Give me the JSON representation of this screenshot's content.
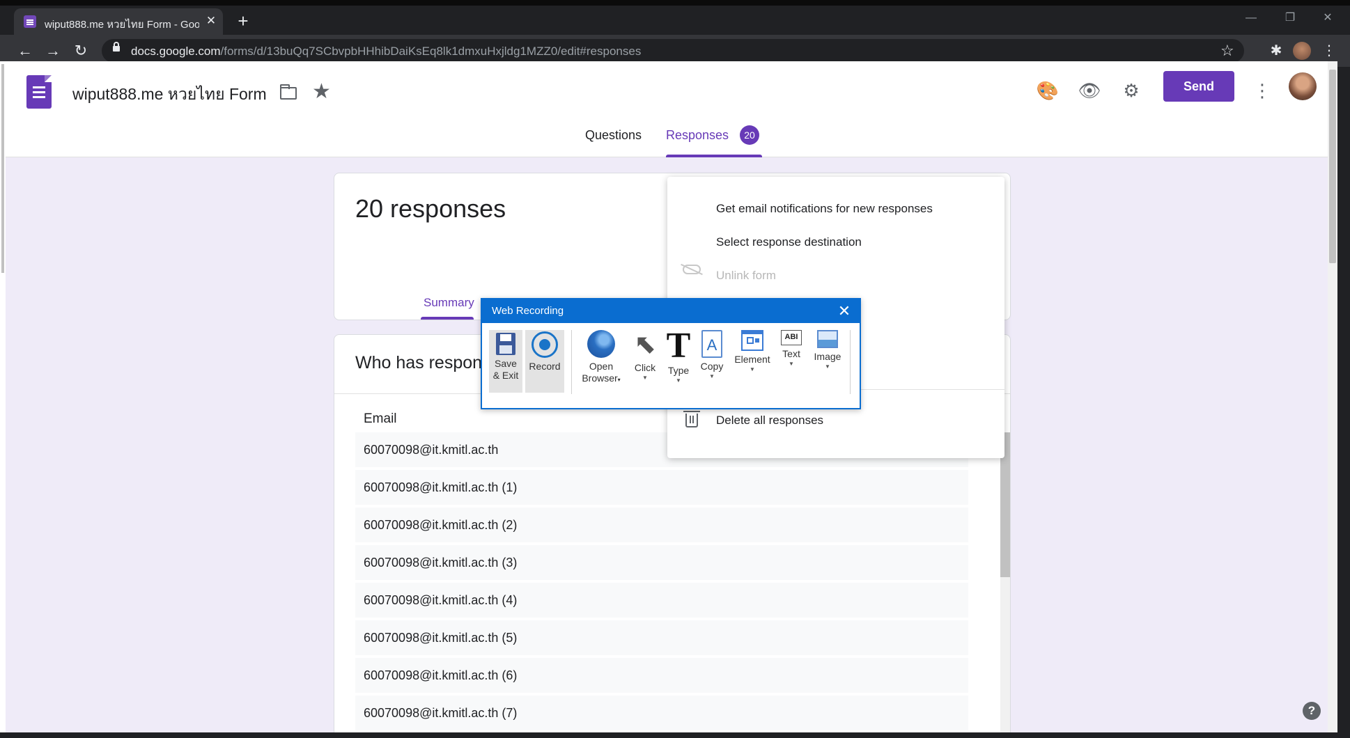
{
  "browser": {
    "tab_title": "wiput888.me หวยไทย Form - Goo",
    "tab_close": "✕",
    "new_tab": "+",
    "url_host": "docs.google.com",
    "url_path": "/forms/d/13buQq7SCbvpbHHhibDaiKsEq8lk1dmxuHxjldg1MZZ0/edit#responses",
    "back": "←",
    "forward": "→",
    "reload": "↻",
    "bookmark_star": "☆",
    "extensions": "✱",
    "menu": "⋮",
    "minimize": "—",
    "restore": "❐",
    "close": "✕"
  },
  "header": {
    "form_title": "wiput888.me หวยไทย Form",
    "star": "★",
    "palette": "🎨",
    "preview": "👁",
    "settings": "⚙",
    "send_label": "Send",
    "more": "⋮"
  },
  "tabs": {
    "questions": "Questions",
    "responses": "Responses",
    "responses_count": "20"
  },
  "summary": {
    "count_label": "20 responses",
    "summary_tab": "Summary"
  },
  "list": {
    "title": "Who has respon",
    "column": "Email",
    "rows": [
      "60070098@it.kmitl.ac.th",
      "60070098@it.kmitl.ac.th (1)",
      "60070098@it.kmitl.ac.th (2)",
      "60070098@it.kmitl.ac.th (3)",
      "60070098@it.kmitl.ac.th (4)",
      "60070098@it.kmitl.ac.th (5)",
      "60070098@it.kmitl.ac.th (6)",
      "60070098@it.kmitl.ac.th (7)"
    ]
  },
  "menu": {
    "notifications": "Get email notifications for new responses",
    "destination": "Select response destination",
    "unlink": "Unlink form",
    "delete_all": "Delete all responses"
  },
  "recorder": {
    "title": "Web Recording",
    "close": "✕",
    "save_exit_1": "Save",
    "save_exit_2": "& Exit",
    "record": "Record",
    "open_browser_1": "Open",
    "open_browser_2": "Browser",
    "click": "Click",
    "type": "Type",
    "type_glyph": "T",
    "copy": "Copy",
    "copy_glyph": "A",
    "element": "Element",
    "text": "Text",
    "text_glyph": "ABI",
    "image": "Image",
    "cursor_glyph": "⬉"
  },
  "help": "?",
  "colors": {
    "accent": "#673ab7",
    "page_bg": "#efebf8",
    "recorder_blue": "#0a6dd0"
  }
}
